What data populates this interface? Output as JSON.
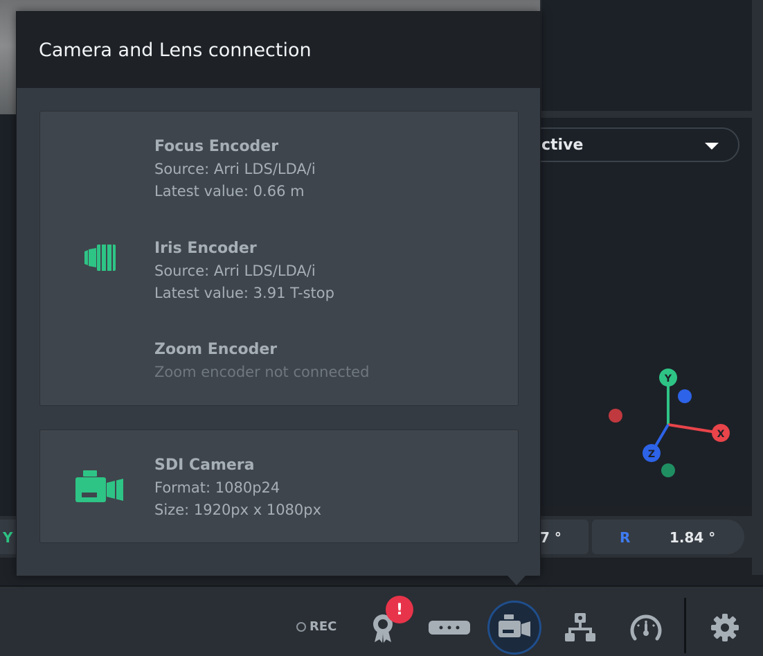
{
  "popup": {
    "title": "Camera and Lens connection",
    "encoders": [
      {
        "title": "Focus Encoder",
        "source": "Source: Arri LDS/LDA/i",
        "latest": "Latest value: 0.66 m"
      },
      {
        "title": "Iris Encoder",
        "source": "Source: Arri LDS/LDA/i",
        "latest": "Latest value: 3.91 T-stop"
      },
      {
        "title": "Zoom Encoder",
        "status": "Zoom encoder not connected"
      }
    ],
    "camera": {
      "title": "SDI Camera",
      "format": "Format: 1080p24",
      "size": "Size: 1920px x 1080px"
    },
    "encoder_icon": "lens-icon",
    "camera_icon": "video-camera-icon"
  },
  "background": {
    "view_select": {
      "value": "ctive"
    },
    "gizmo_axes": {
      "y": "Y",
      "x": "X",
      "z": "Z"
    },
    "values": {
      "left_axis": "Y",
      "mid_value": "7 °",
      "r_axis": "R",
      "r_value": "1.84 °"
    }
  },
  "toolbar": {
    "rec_label": "REC",
    "alert_badge": "!",
    "buttons": [
      "award-icon",
      "tracker-bar-icon",
      "camera-lens-icon",
      "network-icon",
      "speedometer-icon",
      "gear-icon"
    ]
  },
  "colors": {
    "accent_green": "#2ec486",
    "accent_blue": "#3f7cf2",
    "alert_red": "#e8344a"
  }
}
